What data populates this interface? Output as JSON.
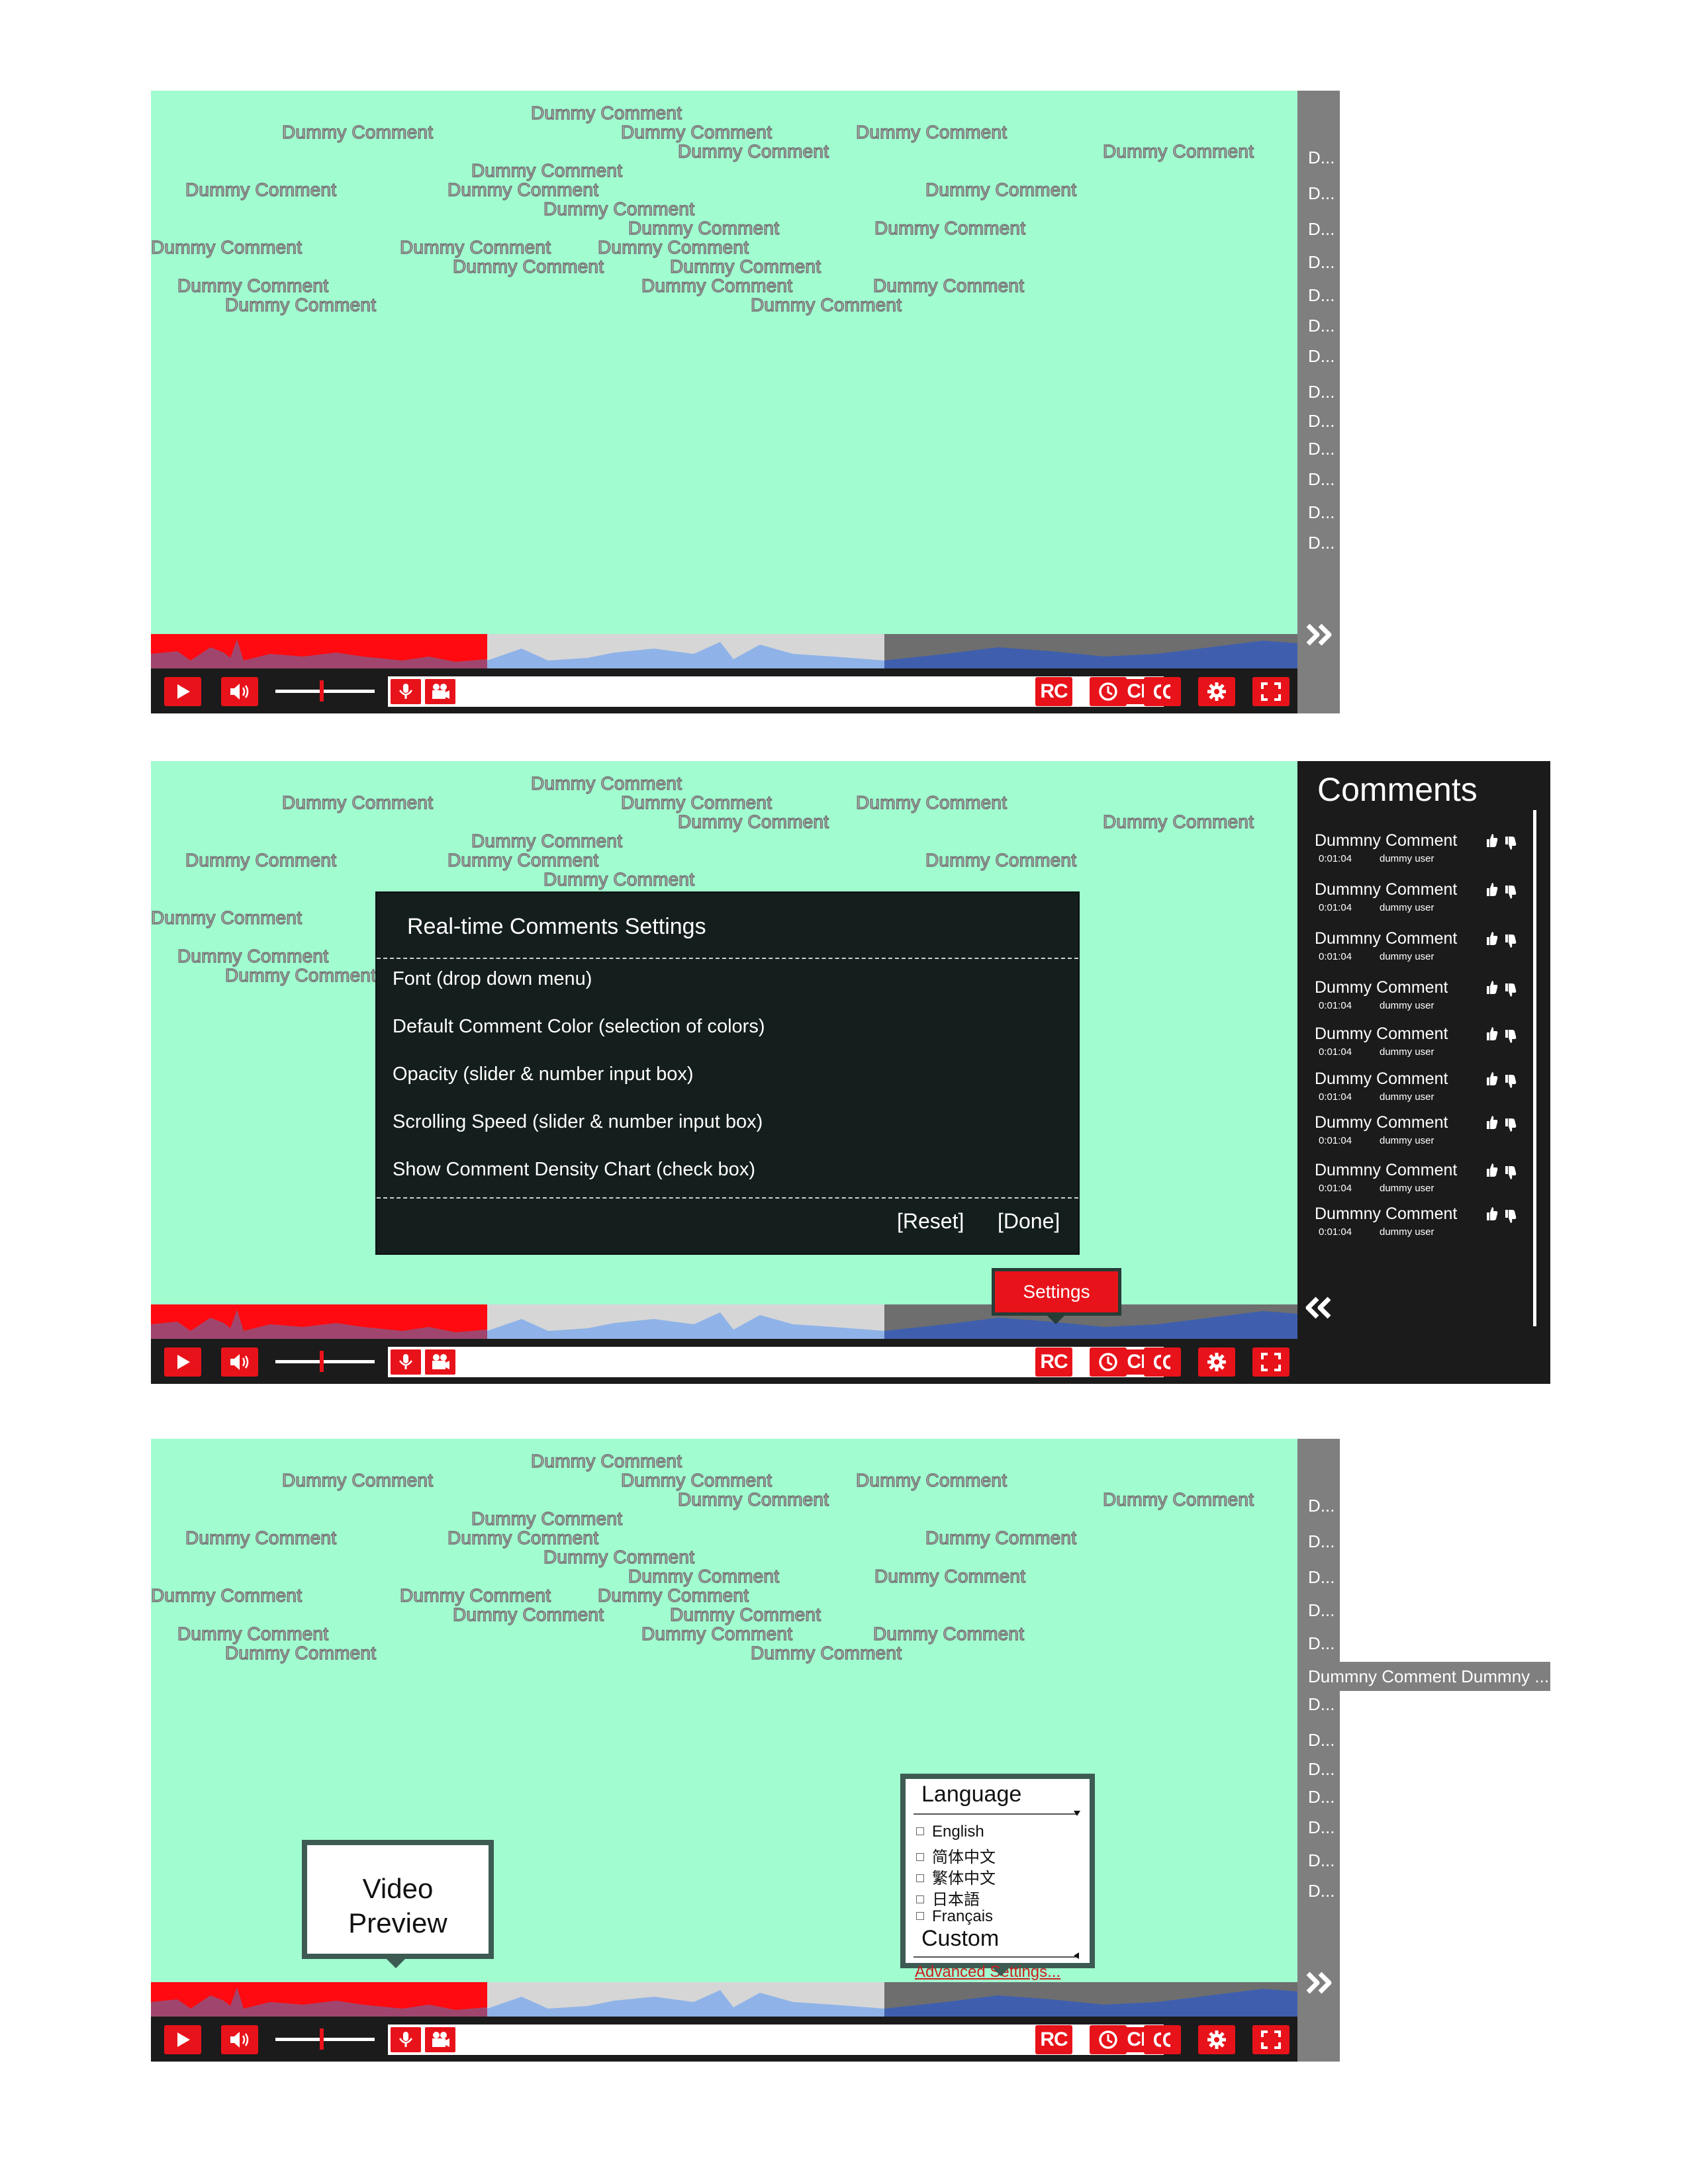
{
  "dummy_comment": "Dummy Comment",
  "rail_items": [
    "D...",
    "D...",
    "D...",
    "D...",
    "D...",
    "D...",
    "D...",
    "D...",
    "D...",
    "D...",
    "D...",
    "D...",
    "D..."
  ],
  "controls": {
    "ch_label": "CH",
    "rc_label": "RC"
  },
  "settings_panel": {
    "title": "Real-time Comments Settings",
    "items": [
      "Font (drop down menu)",
      "Default Comment Color (selection of colors)",
      "Opacity (slider & number input box)",
      "Scrolling Speed (slider & number input box)",
      "Show Comment Density Chart (check box)"
    ],
    "reset": "[Reset]",
    "done": "[Done]",
    "tooltip": "Settings"
  },
  "comments_panel": {
    "title": "Comments",
    "rows": [
      {
        "comment": "Dummny Comment",
        "time": "0:01:04",
        "user": "dummy user"
      },
      {
        "comment": "Dummny Comment",
        "time": "0:01:04",
        "user": "dummy user"
      },
      {
        "comment": "Dummny Comment",
        "time": "0:01:04",
        "user": "dummy user"
      },
      {
        "comment": "Dummy Comment",
        "time": "0:01:04",
        "user": "dummy user"
      },
      {
        "comment": "Dummy Comment",
        "time": "0:01:04",
        "user": "dummy user"
      },
      {
        "comment": "Dummy Comment",
        "time": "0:01:04",
        "user": "dummy user"
      },
      {
        "comment": "Dummy Comment",
        "time": "0:01:04",
        "user": "dummy user"
      },
      {
        "comment": "Dummny Comment",
        "time": "0:01:04",
        "user": "dummy user"
      },
      {
        "comment": "Dummny Comment",
        "time": "0:01:04",
        "user": "dummy user"
      }
    ]
  },
  "frame3": {
    "hover_tip": "Dummny Comment Dummny ...",
    "preview_line1": "Video",
    "preview_line2": "Preview",
    "language": {
      "header": "Language",
      "options": [
        "English",
        "简体中文",
        "繁体中文",
        "日本語",
        "Français"
      ],
      "custom": "Custom",
      "advanced": "Advanced Settings..."
    }
  },
  "colors": {
    "video_bg": "#a1fcd0",
    "accent_red": "#e8131a",
    "bar_dark": "#1b1b1b",
    "rail_gray": "#7f7f7f",
    "popup_border": "#3d5b52"
  }
}
